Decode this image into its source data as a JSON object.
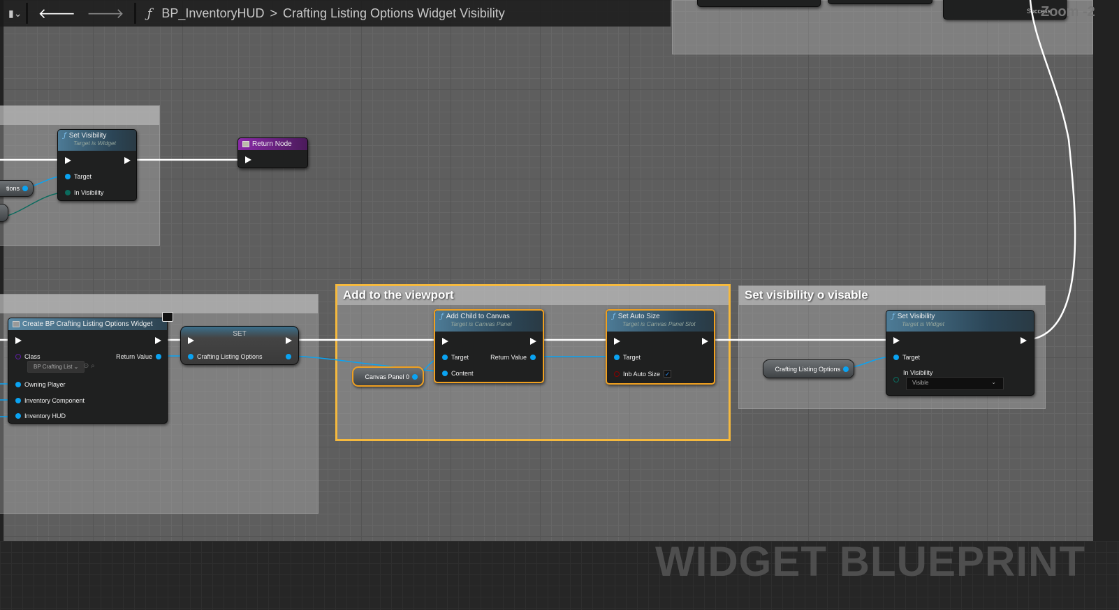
{
  "toolbar": {
    "breadcrumb_root": "BP_InventoryHUD",
    "breadcrumb_sep": ">",
    "breadcrumb_current": "Crafting Listing Options Widget Visibility",
    "function_icon": "ƒ"
  },
  "zoom_label": "Zoom -2",
  "top_right_node": {
    "success_label": "Success"
  },
  "watermark": "WIDGET BLUEPRINT",
  "comments": {
    "viewport": "Add to the viewport",
    "visibility": "Set visibility o visable"
  },
  "nodes": {
    "set_visibility_1": {
      "title": "Set Visibility",
      "subtitle": "Target is Widget",
      "target": "Target",
      "in_visibility": "In Visibility"
    },
    "partial_var": "tions",
    "return_node": {
      "title": "Return Node"
    },
    "create_widget": {
      "title": "Create BP Crafting Listing Options Widget",
      "class": "Class",
      "class_value": "BP Crafting List",
      "return_value": "Return Value",
      "owning_player": "Owning Player",
      "inventory_component": "Inventory Component",
      "inventory_hud": "Inventory HUD"
    },
    "set_node": {
      "title": "SET",
      "var": "Crafting Listing Options"
    },
    "canvas_panel": "Canvas Panel 0",
    "add_child": {
      "title": "Add Child to Canvas",
      "subtitle": "Target is Canvas Panel",
      "target": "Target",
      "content": "Content",
      "return_value": "Return Value"
    },
    "set_auto_size": {
      "title": "Set Auto Size",
      "subtitle": "Target is Canvas Panel Slot",
      "target": "Target",
      "inb": "Inb Auto Size",
      "checked": true
    },
    "crafting_var": "Crafting Listing Options",
    "set_visibility_2": {
      "title": "Set Visibility",
      "subtitle": "Target is Widget",
      "target": "Target",
      "in_visibility": "In Visibility",
      "visibility_value": "Visible"
    }
  }
}
